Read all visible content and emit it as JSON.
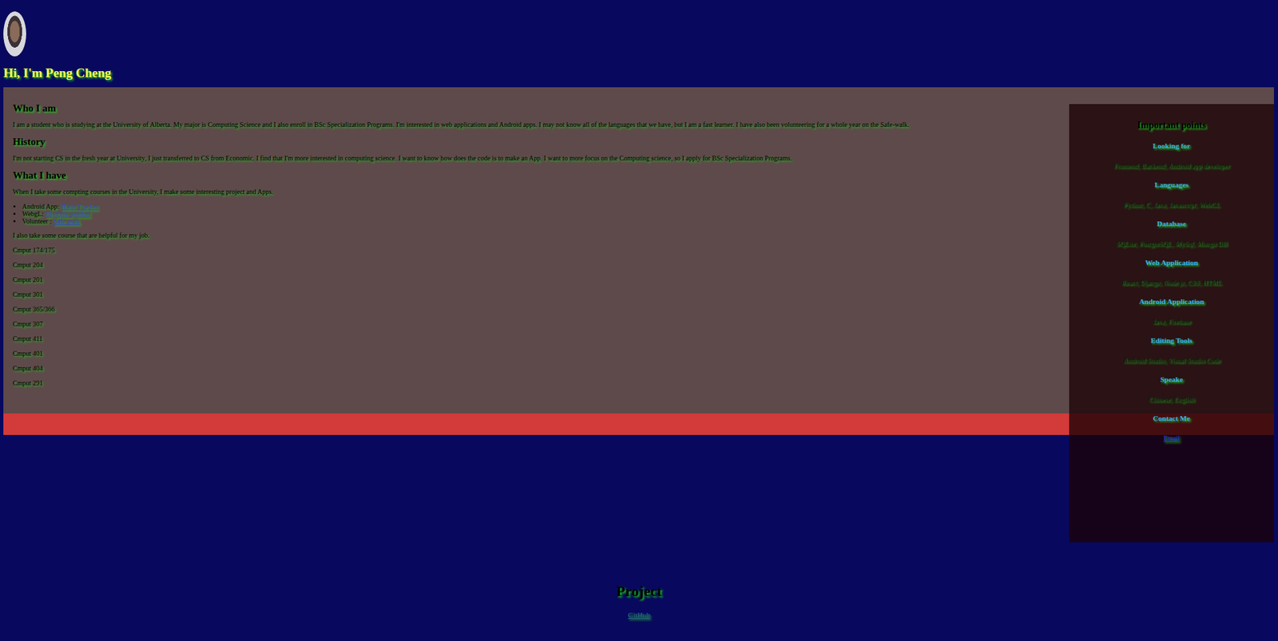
{
  "header": {
    "title": "Hi, I'm Peng Cheng"
  },
  "sections": [
    {
      "heading": "Who I am",
      "paragraph": "I am a student who is studying at the University of Alberta. My major is Computing Science and I also enroll in BSc Specialization Programs. I'm interested in web applications and Android apps. I may not know all of the languages that we have, but I am a fast learner. I have also been volunteering for a whole year on the Safe-walk."
    },
    {
      "heading": "History",
      "paragraph": "I'm not starting CS in the fresh year at University, I just transferred to CS from Economic. I find that I'm more interested in computing science. I want to know how does the code is to make an App. I want to more focus on the Computing science, so I apply for BSc Specialization Programs."
    }
  ],
  "have": {
    "heading": "What I have",
    "intro": "When I take some compting courses in the University, I make some interesting project and Apps.",
    "projects": [
      {
        "label": "Android App:",
        "link": "Habit Tracker"
      },
      {
        "label": "WebgL:",
        "link": "Olympic symbol"
      },
      {
        "label": "Volunteer :",
        "link": "Safe walk"
      }
    ],
    "courses_intro": "I also take some course that are helpful for my job.",
    "courses": [
      "Cmput 174/175",
      "Cmput 204",
      "Cmput 201",
      "Cmput 301",
      "Cmput 365/366",
      "Cmput 307",
      "Cmput 411",
      "Cmput 401",
      "Cmput 404",
      "Cmput 291"
    ]
  },
  "sidebar": {
    "title": "Important points",
    "items": [
      {
        "heading": "Looking for",
        "value": "Frontend, Backend, Android app developer",
        "kind": "text"
      },
      {
        "heading": "Languages",
        "value": "Python, C, Java, Javascript, WebGL",
        "kind": "text"
      },
      {
        "heading": "Database",
        "value": "SQLite, PostgreSQL, MySql, Mongo DB",
        "kind": "text"
      },
      {
        "heading": "Web Application",
        "value": "React, Django, Node.js, CSS, HTML",
        "kind": "text"
      },
      {
        "heading": "Android Application",
        "value": "Java, Firebase",
        "kind": "text"
      },
      {
        "heading": "Editing Tools",
        "value": "Android Studio, Visual Studio Code",
        "kind": "text"
      },
      {
        "heading": "Speake",
        "value": "Chinese, English",
        "kind": "text"
      },
      {
        "heading": "Contact Me",
        "value": "Email",
        "kind": "link"
      }
    ]
  },
  "footer": {
    "heading": "Project",
    "link": "GitHub"
  }
}
